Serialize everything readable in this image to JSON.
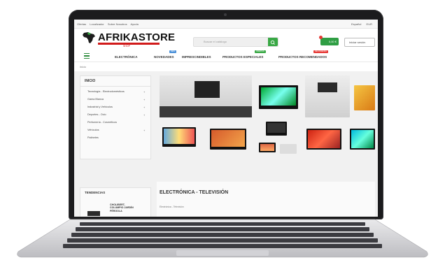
{
  "topbar": {
    "left_links": [
      "Ofertas",
      "Localizador",
      "Sobre Nosotros",
      "Ayuda"
    ],
    "language": "Español",
    "currency": "EUR"
  },
  "header": {
    "logo_text": "AFRIKASTORE",
    "logo_sub": "SHOP",
    "search_placeholder": "Buscar el catálogo",
    "cart_label": "0,00 €",
    "login_label": "Iniciar sesión"
  },
  "nav": {
    "items": [
      "ELECTRÓNICA",
      "NOVEDADES",
      "IMPRESCINDIBLES",
      "PRODUCTOS ESPECIALES",
      "PRODUCTOS RECOMENDADOS"
    ],
    "tags": {
      "novedades": "NEW",
      "especiales": "OFERTAS",
      "recomendados": "RECOMIENDA"
    },
    "tag_colors": {
      "novedades": "#4a90d9",
      "especiales": "#39a845",
      "recomendados": "#e53935"
    }
  },
  "breadcrumb": "Inicio",
  "sidebar": {
    "title": "INICIO",
    "items": [
      "Tecnología - Electrodomésticos",
      "Gama Blanca",
      "Industrial y Vehículos",
      "Deportes - Ocio",
      "Perfumería - Cosméticos",
      "Vehículos",
      "Patinetes"
    ],
    "expandable": [
      true,
      true,
      true,
      true,
      false,
      true,
      false
    ],
    "expand_glyph": "+"
  },
  "trends": {
    "title": "TENDENCIAS",
    "product_lines": [
      "CHOLIBERT,",
      "COLUMPIO JARDÍN",
      "PÉRGOLA"
    ]
  },
  "section": {
    "title": "ELECTRÓNICA - TELEVISIÓN",
    "subtitle": "Electrónica - Televisión"
  },
  "colors": {
    "brand_green": "#39a845",
    "brand_red": "#d11a1a",
    "cart_green": "#2f9e44"
  }
}
